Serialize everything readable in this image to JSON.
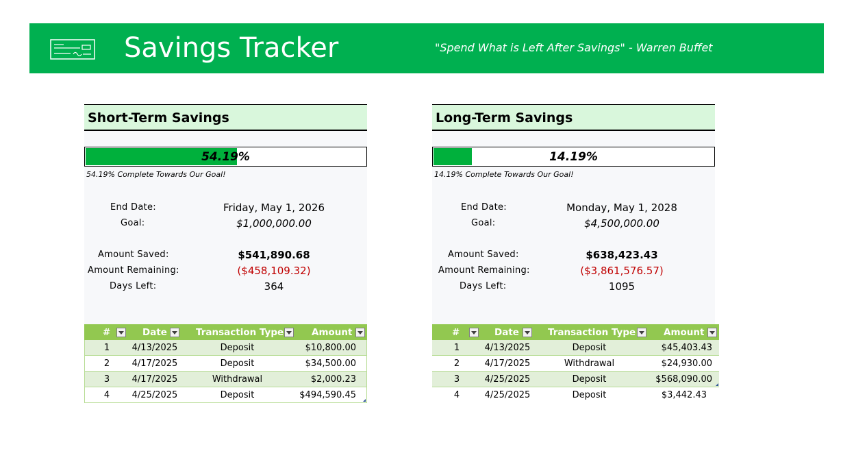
{
  "header": {
    "title": "Savings Tracker",
    "quote": "\"Spend What is Left After Savings\" - Warren Buffet",
    "icon": "check-icon",
    "brand_color": "#00b050"
  },
  "short_term": {
    "title": "Short-Term Savings",
    "progress_percent": 54.19,
    "progress_label": "54.19%",
    "progress_caption": "54.19% Complete Towards Our Goal!",
    "end_date_label": "End Date:",
    "end_date": "Friday, May 1, 2026",
    "goal_label": "Goal:",
    "goal": "$1,000,000.00",
    "saved_label": "Amount Saved:",
    "saved": "$541,890.68",
    "remaining_label": "Amount Remaining:",
    "remaining": "($458,109.32)",
    "days_label": "Days Left:",
    "days": "364",
    "table": {
      "headers": [
        "#",
        "Date",
        "Transaction Type",
        "Amount"
      ],
      "rows": [
        {
          "num": "1",
          "date": "4/13/2025",
          "type": "Deposit",
          "amount": "$10,800.00"
        },
        {
          "num": "2",
          "date": "4/17/2025",
          "type": "Deposit",
          "amount": "$34,500.00"
        },
        {
          "num": "3",
          "date": "4/17/2025",
          "type": "Withdrawal",
          "amount": "$2,000.23"
        },
        {
          "num": "4",
          "date": "4/25/2025",
          "type": "Deposit",
          "amount": "$494,590.45"
        }
      ]
    }
  },
  "long_term": {
    "title": "Long-Term Savings",
    "progress_percent": 14.19,
    "progress_label": "14.19%",
    "progress_caption": "14.19% Complete Towards Our Goal!",
    "end_date_label": "End Date:",
    "end_date": "Monday, May 1, 2028",
    "goal_label": "Goal:",
    "goal": "$4,500,000.00",
    "saved_label": "Amount Saved:",
    "saved": "$638,423.43",
    "remaining_label": "Amount Remaining:",
    "remaining": "($3,861,576.57)",
    "days_label": "Days Left:",
    "days": "1095",
    "table": {
      "headers": [
        "#",
        "Date",
        "Transaction Type",
        "Amount"
      ],
      "rows": [
        {
          "num": "1",
          "date": "4/13/2025",
          "type": "Deposit",
          "amount": "$45,403.43"
        },
        {
          "num": "2",
          "date": "4/17/2025",
          "type": "Withdrawal",
          "amount": "$24,930.00"
        },
        {
          "num": "3",
          "date": "4/25/2025",
          "type": "Deposit",
          "amount": "$568,090.00"
        },
        {
          "num": "4",
          "date": "4/25/2025",
          "type": "Deposit",
          "amount": "$3,442.43"
        }
      ]
    }
  },
  "colors": {
    "progress_fill": "#00b03c",
    "table_header": "#92c850",
    "row_shade": "#e2efd9",
    "negative": "#c00000",
    "panel_header_bg": "#d9f7dc"
  }
}
